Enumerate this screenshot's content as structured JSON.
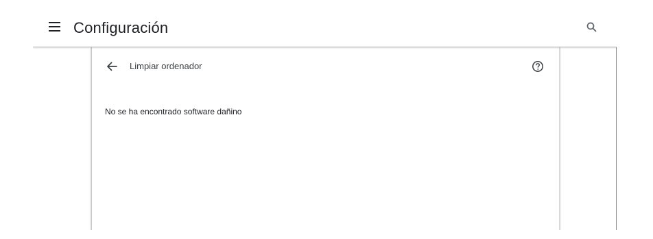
{
  "header": {
    "title": "Configuración",
    "menu_icon": "hamburger-menu-icon",
    "search_icon": "search-icon"
  },
  "subpage": {
    "title": "Limpiar ordenador",
    "back_icon": "arrow-left-icon",
    "help_icon": "help-circle-icon",
    "message": "No se ha encontrado software dañino"
  },
  "colors": {
    "text_primary": "#202124",
    "text_secondary": "#3c4043",
    "icon": "#5f6368",
    "background": "#ffffff",
    "divider": "#c8c8c8"
  }
}
